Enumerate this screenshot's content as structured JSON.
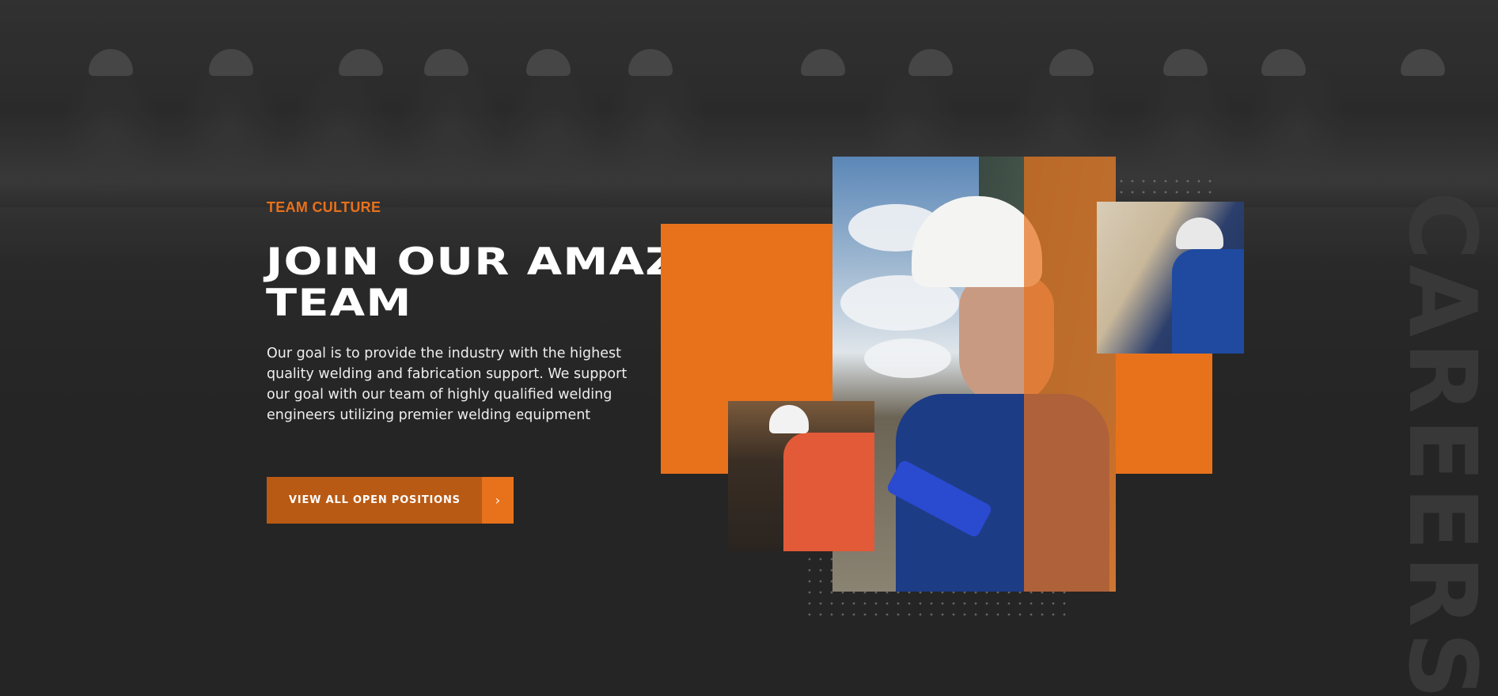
{
  "section": {
    "eyebrow": "TEAM CULTURE",
    "headline_line1": "JOIN OUR AMAZING",
    "headline_line2": "TEAM",
    "body": "Our goal is to provide the industry with the highest quality welding and fabrication support. We support our goal with our team of highly qualified welding engineers utilizing premier welding equipment",
    "side_word": "CAREERS"
  },
  "cta": {
    "label": "VIEW ALL OPEN POSITIONS",
    "arrow": "›"
  },
  "colors": {
    "accent": "#e8711b",
    "button": "#b95a14",
    "background": "#232323"
  },
  "icons": {
    "cta_arrow": "chevron-right-icon"
  }
}
